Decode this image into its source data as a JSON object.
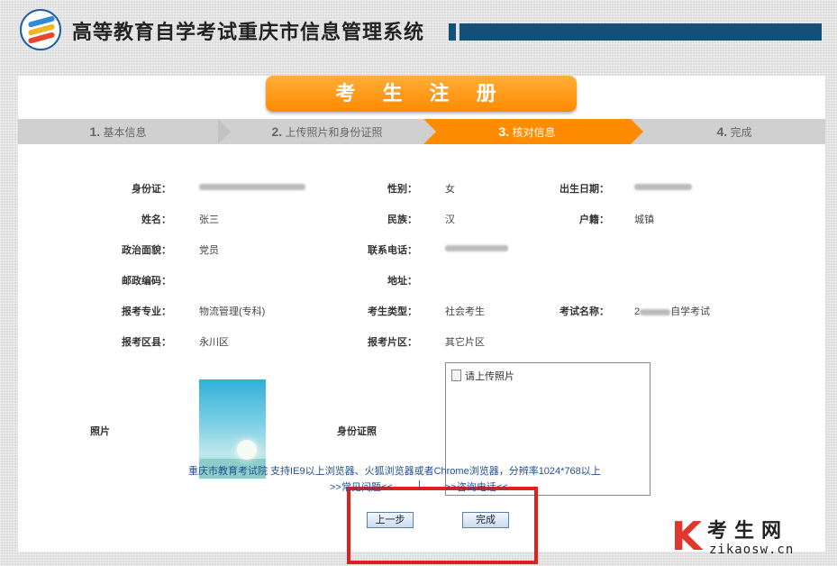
{
  "header": {
    "title": "高等教育自学考试重庆市信息管理系统"
  },
  "page": {
    "title": "考 生 注 册"
  },
  "steps": [
    {
      "num": "1.",
      "label": "基本信息"
    },
    {
      "num": "2.",
      "label": "上传照片和身份证照"
    },
    {
      "num": "3.",
      "label": "核对信息"
    },
    {
      "num": "4.",
      "label": "完成"
    }
  ],
  "active_step": 3,
  "fields": {
    "id_card": {
      "label": "身份证：",
      "value": ""
    },
    "gender": {
      "label": "性别：",
      "value": "女"
    },
    "birth": {
      "label": "出生日期：",
      "value": ""
    },
    "name": {
      "label": "姓名：",
      "value": "张三"
    },
    "ethnic": {
      "label": "民族：",
      "value": "汉"
    },
    "hukou": {
      "label": "户籍：",
      "value": "城镇"
    },
    "political": {
      "label": "政治面貌：",
      "value": "党员"
    },
    "phone": {
      "label": "联系电话：",
      "value": ""
    },
    "postcode": {
      "label": "邮政编码：",
      "value": ""
    },
    "address": {
      "label": "地址：",
      "value": ""
    },
    "major": {
      "label": "报考专业：",
      "value": "物流管理(专科)"
    },
    "type": {
      "label": "考生类型：",
      "value": "社会考生"
    },
    "exam": {
      "label": "考试名称：",
      "value_prefix": "2",
      "value_suffix": "自学考试"
    },
    "district": {
      "label": "报考区县：",
      "value": "永川区"
    },
    "area": {
      "label": "报考片区：",
      "value": "其它片区"
    }
  },
  "photo": {
    "label": "照片"
  },
  "idphoto": {
    "label": "身份证照",
    "placeholder": "请上传照片"
  },
  "buttons": {
    "prev": "上一步",
    "finish": "完成"
  },
  "footer": {
    "line1": "重庆市教育考试院    支持IE9以上浏览器、火狐浏览器或者Chrome浏览器，分辨率1024*768以上",
    "faq": ">>常见问题<<",
    "sep": "|",
    "consult": ">>咨询电话<<"
  },
  "watermark": {
    "letter": "K",
    "text": "考生网",
    "url": "zikaosw.cn"
  },
  "colors": {
    "accent": "#ff8c00",
    "header_bar": "#15507a",
    "highlight": "#e02020"
  }
}
